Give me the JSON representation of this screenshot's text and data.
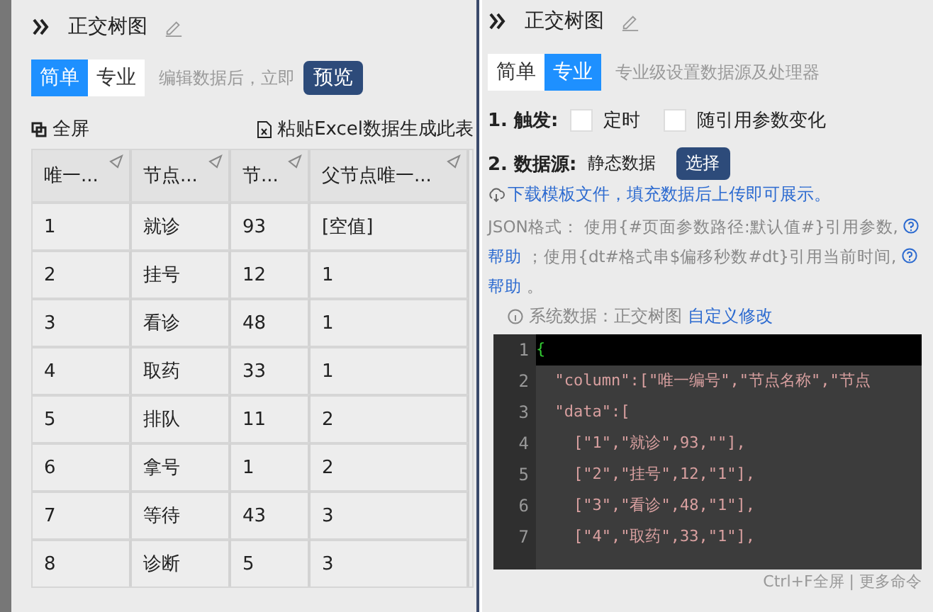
{
  "left": {
    "title": "正交树图",
    "modes": [
      {
        "label": "简单",
        "selected": true
      },
      {
        "label": "专业",
        "selected": false
      }
    ],
    "hint": "编辑数据后，立即",
    "preview_button": "预览",
    "fullscreen": "全屏",
    "paste_excel": "粘贴Excel数据生成此表",
    "table": {
      "columns": [
        "唯一...",
        "节点...",
        "节...",
        "父节点唯一..."
      ],
      "rows": [
        [
          "1",
          "就诊",
          "93",
          "[空值]"
        ],
        [
          "2",
          "挂号",
          "12",
          "1"
        ],
        [
          "3",
          "看诊",
          "48",
          "1"
        ],
        [
          "4",
          "取药",
          "33",
          "1"
        ],
        [
          "5",
          "排队",
          "11",
          "2"
        ],
        [
          "6",
          "拿号",
          "1",
          "2"
        ],
        [
          "7",
          "等待",
          "43",
          "3"
        ],
        [
          "8",
          "诊断",
          "5",
          "3"
        ]
      ]
    }
  },
  "right": {
    "title": "正交树图",
    "modes": [
      {
        "label": "简单",
        "selected": false
      },
      {
        "label": "专业",
        "selected": true
      }
    ],
    "hint": "专业级设置数据源及处理器",
    "trigger": {
      "label": "1. 触发:",
      "options": [
        {
          "label": "定时",
          "checked": false
        },
        {
          "label": "随引用参数变化",
          "checked": false
        }
      ]
    },
    "source": {
      "label": "2. 数据源:",
      "value": "静态数据",
      "button": "选择"
    },
    "download": "下载模板文件，填充数据后上传即可展示。",
    "json_help": [
      "JSON格式： 使用{#页面参数路径:默认值#}引用参数,",
      "帮助",
      "；使用{dt#格式串$偏移秒数#dt}引用当前时间,",
      "帮助",
      "。"
    ],
    "system_data": "系统数据：正交树图",
    "custom_edit": "自定义修改",
    "code_lines": [
      {
        "number": "1",
        "text": "{"
      },
      {
        "number": "2",
        "text": "  \"column\":[\"唯一编号\",\"节点名称\",\"节点"
      },
      {
        "number": "3",
        "text": "  \"data\":["
      },
      {
        "number": "4",
        "text": "    [\"1\",\"就诊\",93,\"\"],"
      },
      {
        "number": "5",
        "text": "    [\"2\",\"挂号\",12,\"1\"],"
      },
      {
        "number": "6",
        "text": "    [\"3\",\"看诊\",48,\"1\"],"
      },
      {
        "number": "7",
        "text": "    [\"4\",\"取药\",33,\"1\"],"
      }
    ],
    "footer": "Ctrl+F全屏 | 更多命令"
  }
}
